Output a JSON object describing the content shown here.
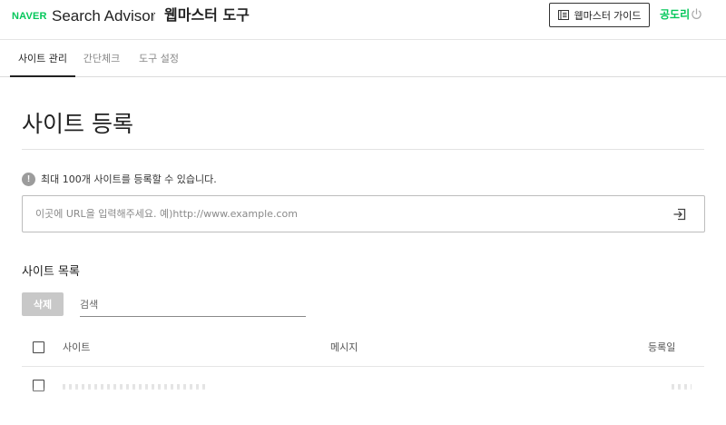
{
  "header": {
    "logo": "NAVER",
    "product": "Search Advisor",
    "tool_title": "웹마스터 도구",
    "guide_button": "웹마스터 가이드",
    "user_name": "공도리",
    "icons": {
      "guide": "book-icon",
      "logout": "power-icon"
    }
  },
  "tabs": [
    {
      "label": "사이트 관리",
      "active": true
    },
    {
      "label": "간단체크",
      "active": false
    },
    {
      "label": "도구 설정",
      "active": false
    }
  ],
  "main": {
    "title": "사이트 등록",
    "notice": "최대 100개 사이트를 등록할 수 있습니다.",
    "url_placeholder": "이곳에 URL을 입력해주세요. 예)http://www.example.com",
    "url_value": "",
    "submit_icon": "enter-icon"
  },
  "site_list": {
    "title": "사이트 목록",
    "delete_button": "삭제",
    "search_placeholder": "검색",
    "columns": [
      "사이트",
      "메시지",
      "등록일"
    ]
  },
  "colors": {
    "brand": "#03c75a",
    "text": "#222222",
    "disabled_button": "#c8c8c8",
    "notice_icon": "#9c9c9c"
  }
}
